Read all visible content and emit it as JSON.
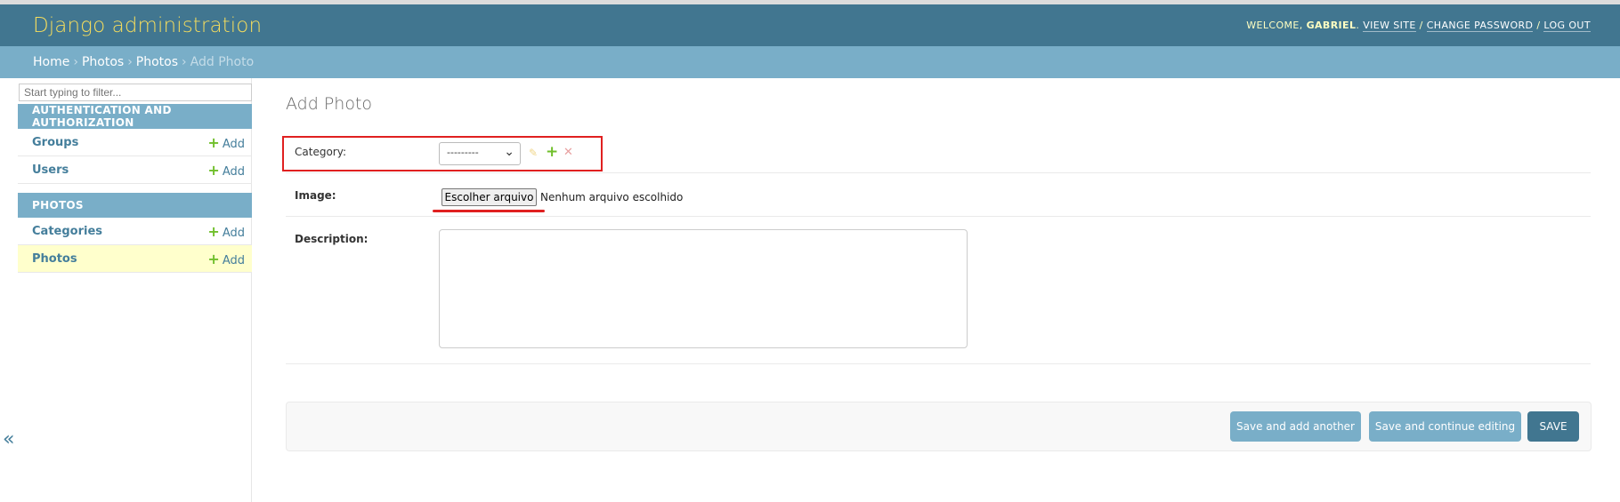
{
  "header": {
    "brand": "Django administration",
    "welcome_prefix": "WELCOME, ",
    "username": "GABRIEL",
    "welcome_suffix": ". ",
    "view_site": "VIEW SITE",
    "change_password": "CHANGE PASSWORD",
    "log_out": "LOG OUT",
    "separator": " / "
  },
  "breadcrumbs": {
    "home": "Home",
    "app": "Photos",
    "model": "Photos",
    "current": "Add Photo",
    "sep": "›"
  },
  "sidebar": {
    "filter_placeholder": "Start typing to filter...",
    "toggle": "«",
    "modules": [
      {
        "caption": "AUTHENTICATION AND AUTHORIZATION",
        "rows": [
          {
            "name": "Groups",
            "add": "Add"
          },
          {
            "name": "Users",
            "add": "Add"
          }
        ]
      },
      {
        "caption": "PHOTOS",
        "rows": [
          {
            "name": "Categories",
            "add": "Add"
          },
          {
            "name": "Photos",
            "add": "Add"
          }
        ]
      }
    ]
  },
  "form": {
    "title": "Add Photo",
    "category_label": "Category:",
    "category_value": "---------",
    "image_label": "Image:",
    "file_button": "Escolher arquivo",
    "file_status": "Nenhum arquivo escolhido",
    "description_label": "Description:"
  },
  "actions": {
    "save_add_another": "Save and add another",
    "save_continue": "Save and continue editing",
    "save": "SAVE"
  },
  "colors": {
    "header_bg": "#417690",
    "breadcrumb_bg": "#79aec8",
    "brand": "#f5dd5d",
    "highlight_row": "#ffffcc",
    "annotation_red": "#e02020"
  }
}
